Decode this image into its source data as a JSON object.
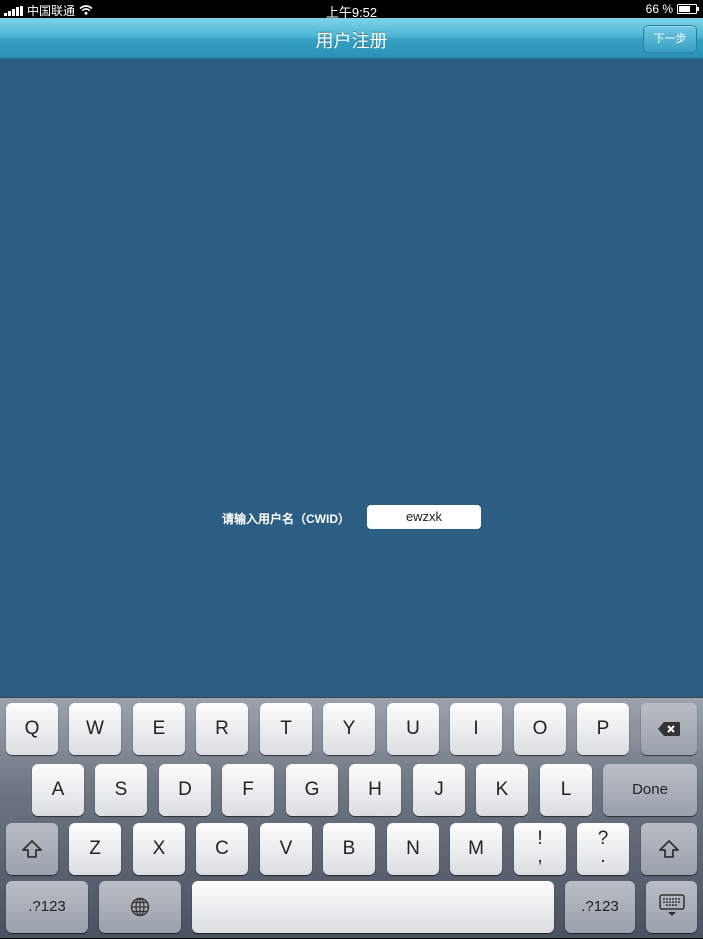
{
  "status_bar": {
    "carrier": "中国联通",
    "time": "上午9:52",
    "battery": "66 %",
    "battery_level": 0.66
  },
  "nav": {
    "title": "用户注册",
    "next_label": "下一步"
  },
  "form": {
    "label": "请输入用户名（CWID）",
    "value": "ewzxk"
  },
  "keyboard": {
    "row1": [
      "Q",
      "W",
      "E",
      "R",
      "T",
      "Y",
      "U",
      "I",
      "O",
      "P"
    ],
    "row2": [
      "A",
      "S",
      "D",
      "F",
      "G",
      "H",
      "J",
      "K",
      "L"
    ],
    "row3": [
      "Z",
      "X",
      "C",
      "V",
      "B",
      "N",
      "M"
    ],
    "done_label": "Done",
    "exclam_top": "!",
    "exclam_bottom": ",",
    "question_top": "?",
    "question_bottom": ".",
    "num_label_left": ".?123",
    "num_label_right": ".?123",
    "icons": {
      "delete": "backspace-icon",
      "shift": "shift-icon",
      "globe": "globe-icon",
      "hide": "keyboard-hide-icon"
    }
  },
  "colors": {
    "background": "#2c5e83",
    "nav_gradient_top": "#7fd3e9",
    "nav_gradient_bottom": "#2b8fb4"
  }
}
